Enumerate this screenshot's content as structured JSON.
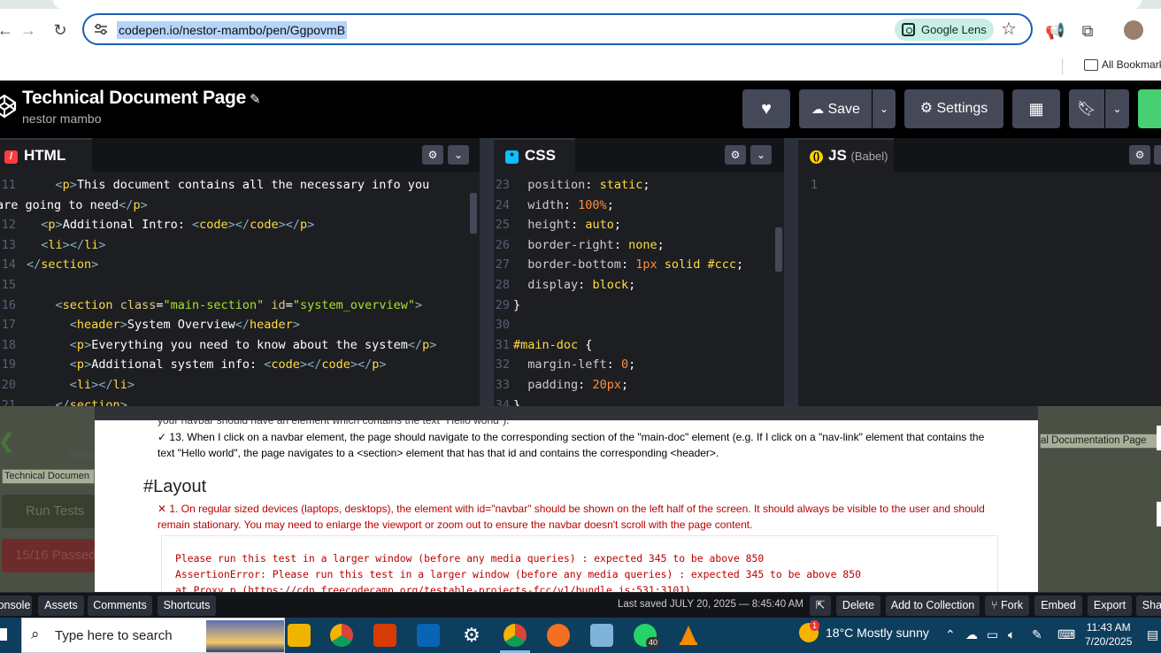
{
  "browser": {
    "url": "codepen.io/nestor-mambo/pen/GgpovmB",
    "lens_label": "Google Lens",
    "bookmarks_label": "All Bookmarks"
  },
  "codepen": {
    "title": "Technical Document Page",
    "author": "nestor mambo",
    "save_label": "Save",
    "settings_label": "Settings"
  },
  "editors": {
    "html": {
      "label": "HTML",
      "lines": [
        {
          "n": "11",
          "code": "    <p>This document contains all the necessary info you"
        },
        {
          "n": "",
          "code": "are going to need</p>"
        },
        {
          "n": "12",
          "code": "  <p>Additional Intro: <code></code></p>"
        },
        {
          "n": "13",
          "code": "  <li></li>"
        },
        {
          "n": "14",
          "code": "</section>"
        },
        {
          "n": "15",
          "code": ""
        },
        {
          "n": "16",
          "code": "    <section class=\"main-section\" id=\"system_overview\">"
        },
        {
          "n": "17",
          "code": "      <header>System Overview</header>"
        },
        {
          "n": "18",
          "code": "      <p>Everything you need to know about the system</p>"
        },
        {
          "n": "19",
          "code": "      <p>Additional system info: <code></code></p>"
        },
        {
          "n": "20",
          "code": "      <li></li>"
        },
        {
          "n": "21",
          "code": "    </section>"
        }
      ]
    },
    "css": {
      "label": "CSS",
      "lines": [
        {
          "n": "23",
          "code": "  position: static;"
        },
        {
          "n": "24",
          "code": "  width: 100%;"
        },
        {
          "n": "25",
          "code": "  height: auto;"
        },
        {
          "n": "26",
          "code": "  border-right: none;"
        },
        {
          "n": "27",
          "code": "  border-bottom: 1px solid #ccc;"
        },
        {
          "n": "28",
          "code": "  display: block;"
        },
        {
          "n": "29",
          "code": "}"
        },
        {
          "n": "30",
          "code": ""
        },
        {
          "n": "31",
          "code": "#main-doc {"
        },
        {
          "n": "32",
          "code": "  margin-left: 0;"
        },
        {
          "n": "33",
          "code": "  padding: 20px;"
        },
        {
          "n": "34",
          "code": "}"
        }
      ]
    },
    "js": {
      "label": "JS",
      "sublabel": "(Babel)",
      "line_number": "1"
    }
  },
  "tests": {
    "partial_line": "your navbar should have an element which contains the text \"Hello world\").",
    "test13_line1": "✓ 13. When I click on a navbar element, the page should navigate to the corresponding section of the \"main-doc\" element (e.g. If I click on a \"nav-link\" element that contains the",
    "test13_line2": "text \"Hello world\", the page navigates to a <section> element that has that id and contains the corresponding <header>.",
    "layout_heading": "#Layout",
    "layout1_line1": "✕ 1. On regular sized devices (laptops, desktops), the element with id=\"navbar\" should be shown on the left half of the screen. It should always be visible to the user and should",
    "layout1_line2": "remain stationary. You may need to enlarge the viewport or zoom out to ensure the navbar doesn't scroll with the page content.",
    "error1": "Please run this test in a larger window (before any media queries) : expected 345 to be above 850",
    "error2": "AssertionError: Please run this test in a larger window (before any media queries) : expected 345 to be above 850",
    "error3": "    at Proxy.p (https://cdn.freecodecamp.org/testable-projects-fcc/v1/bundle.js:531:3101)",
    "left_sele": "Sele",
    "left_tdoc": "Technical Documen",
    "left_run": "Run Tests",
    "left_passed": "15/16 Passed",
    "right_tdoc": "al Documentation Page"
  },
  "footer": {
    "console": "onsole",
    "assets": "Assets",
    "comments": "Comments",
    "shortcuts": "Shortcuts",
    "last_saved": "Last saved JULY 20, 2025 — 8:45:40 AM",
    "delete": "Delete",
    "add_collection": "Add to Collection",
    "fork": "Fork",
    "embed": "Embed",
    "export": "Export",
    "share": "Shar"
  },
  "taskbar": {
    "search_placeholder": "Type here to search",
    "whatsapp_badge": "40",
    "weather": "18°C  Mostly sunny",
    "weather_badge": "1",
    "time": "11:43 AM",
    "date": "7/20/2025"
  },
  "colors": {
    "accent": "#1a5fb4",
    "codepen_bg": "#000000",
    "fail": "#bb0000",
    "pass": "#2e7d32"
  }
}
